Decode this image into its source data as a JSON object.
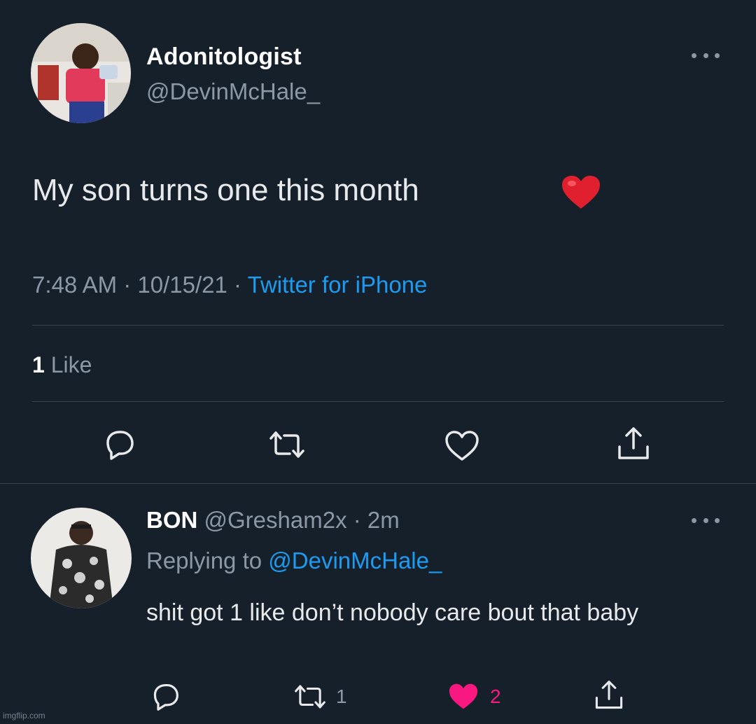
{
  "main_tweet": {
    "display_name": "Adonitologist",
    "handle": "@DevinMcHale_",
    "text": "My son turns one this month",
    "emoji": "red-heart",
    "time": "7:48 AM",
    "separator": " · ",
    "date": "10/15/21",
    "source": "Twitter for iPhone",
    "likes_count": "1",
    "likes_label": " Like",
    "actions": [
      "reply-icon",
      "retweet-icon",
      "like-icon",
      "share-icon"
    ]
  },
  "reply": {
    "display_name": "BON",
    "handle": "@Gresham2x",
    "separator": " · ",
    "age": "2m",
    "replying_prefix": "Replying to ",
    "replying_to": "@DevinMcHale_",
    "text": "shit got 1 like don’t nobody care bout that baby",
    "retweet_count": "1",
    "like_count": "2",
    "liked": true
  },
  "colors": {
    "background": "#15202b",
    "link": "#1d9bf0",
    "muted": "#8b98a5",
    "like": "#f91880"
  },
  "watermark": "imgflip.com"
}
